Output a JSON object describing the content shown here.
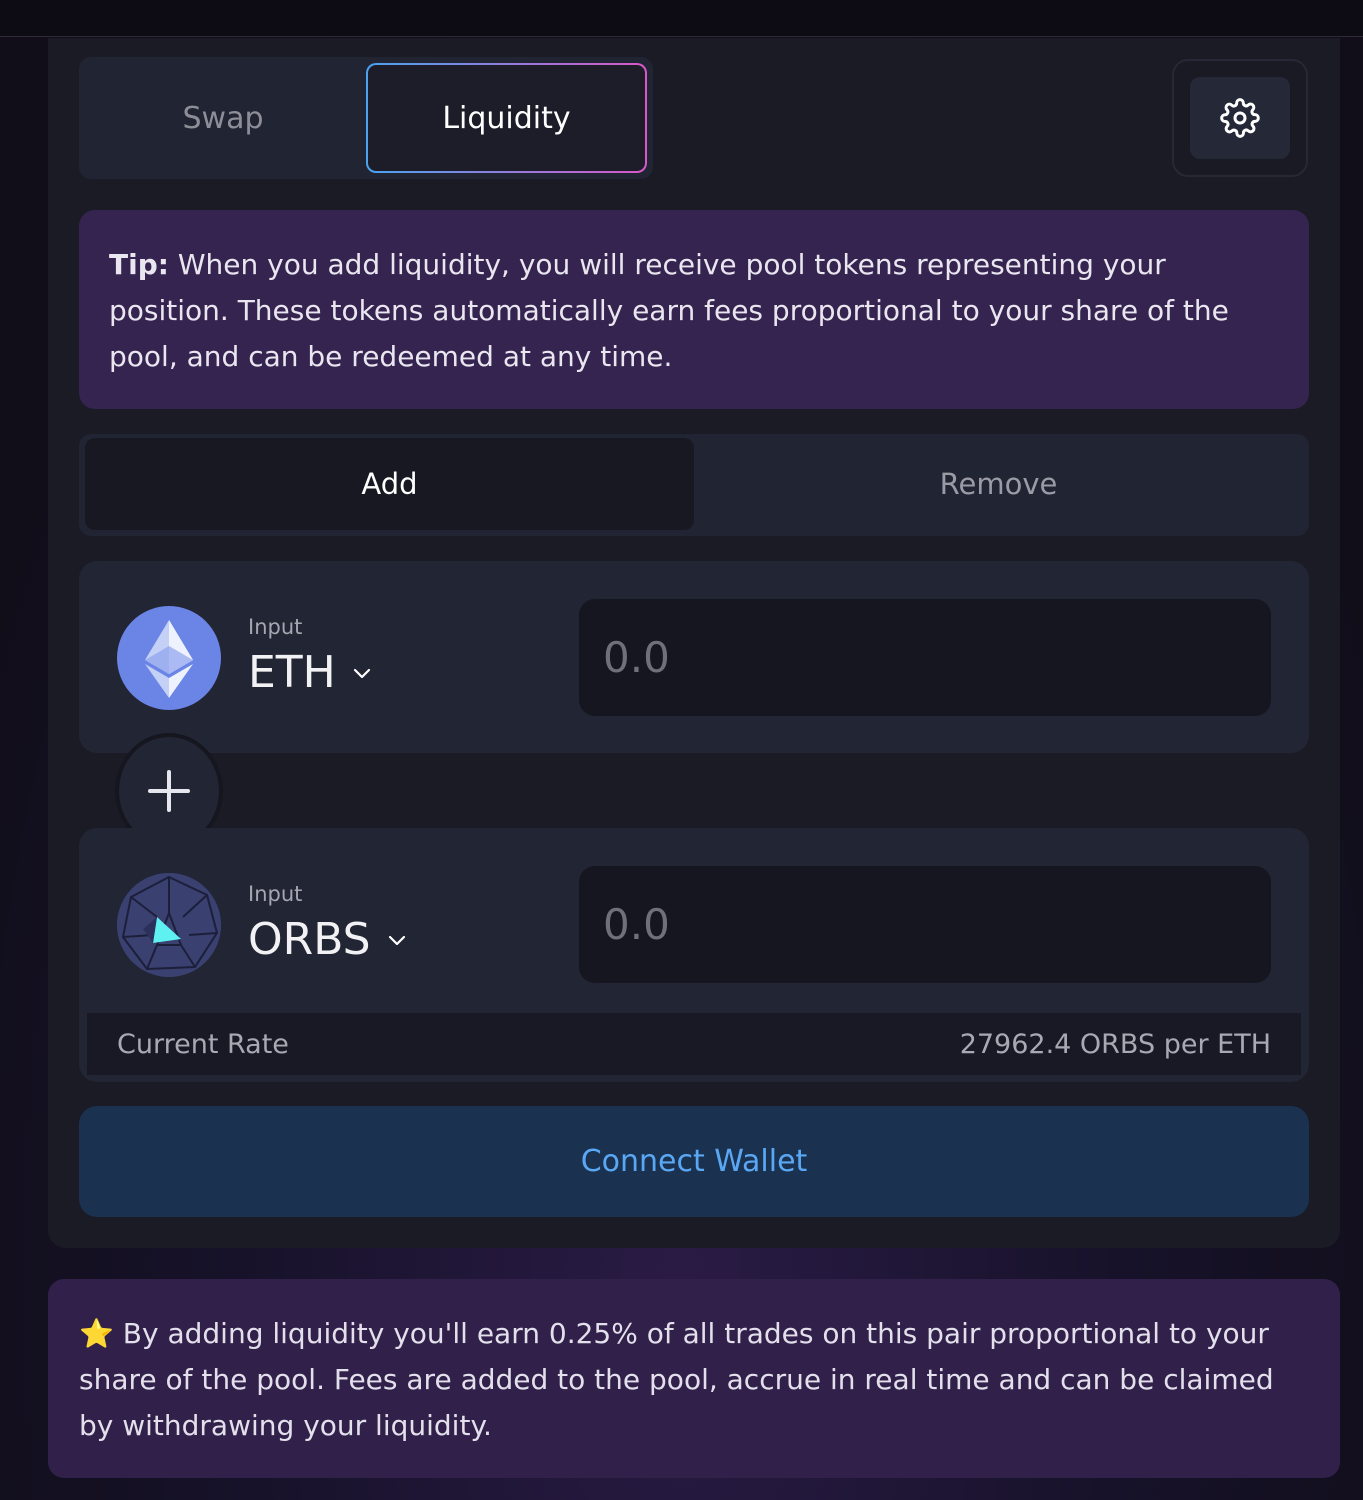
{
  "tabs": {
    "swap": "Swap",
    "liquidity": "Liquidity"
  },
  "settings": {
    "icon": "gear-icon"
  },
  "tip": {
    "bold": "Tip:",
    "text": " When you add liquidity, you will receive pool tokens representing your position. These tokens automatically earn fees proportional to your share of the pool, and can be redeemed at any time."
  },
  "segments": {
    "add": "Add",
    "remove": "Remove"
  },
  "token_a": {
    "label": "Input",
    "symbol": "ETH",
    "placeholder": "0.0",
    "icon": "ethereum-logo-icon"
  },
  "token_b": {
    "label": "Input",
    "symbol": "ORBS",
    "placeholder": "0.0",
    "icon": "orbs-logo-icon"
  },
  "rate": {
    "label": "Current Rate",
    "value": "27962.4 ORBS per ETH"
  },
  "connect": {
    "label": "Connect Wallet"
  },
  "note": {
    "star": "⭐",
    "text": "By adding liquidity you'll earn 0.25% of all trades on this pair proportional to your share of the pool. Fees are added to the pool, accrue in real time and can be claimed by withdrawing your liquidity."
  },
  "colors": {
    "accent_blue": "#5aa8f5",
    "tip_bg": "#35244f",
    "connect_bg": "#1a3250"
  }
}
